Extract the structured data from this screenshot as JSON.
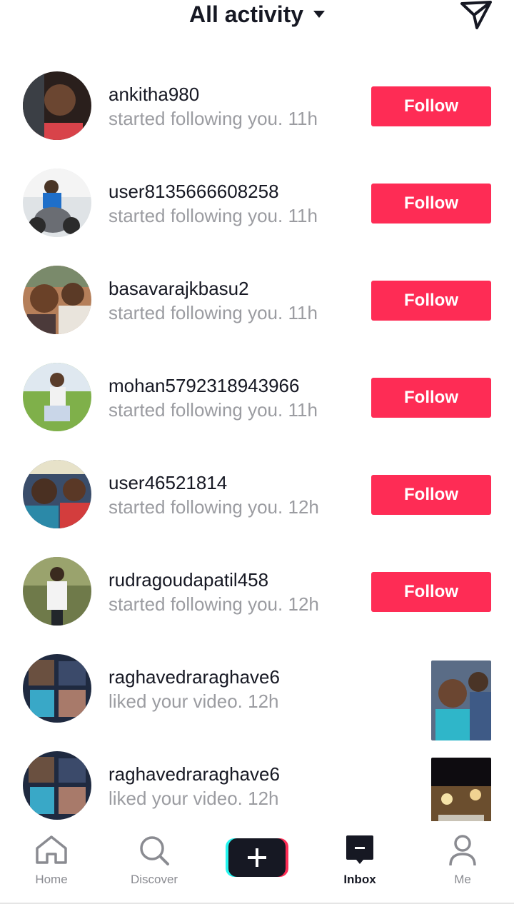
{
  "header": {
    "title": "All activity",
    "send_icon": "send-paper-plane-icon"
  },
  "items": [
    {
      "username": "ankitha980",
      "action": "started following you.",
      "time": "11h",
      "button": "Follow"
    },
    {
      "username": "user8135666608258",
      "action": "started following you.",
      "time": "11h",
      "button": "Follow"
    },
    {
      "username": "basavarajkbasu2",
      "action": "started following you.",
      "time": "11h",
      "button": "Follow"
    },
    {
      "username": "mohan5792318943966",
      "action": "started following you.",
      "time": "11h",
      "button": "Follow"
    },
    {
      "username": "user46521814",
      "action": "started following you.",
      "time": "12h",
      "button": "Follow"
    },
    {
      "username": "rudragoudapatil458",
      "action": "started following you.",
      "time": "12h",
      "button": "Follow"
    },
    {
      "username": "raghavedraraghave6",
      "action": "liked your video.",
      "time": "12h"
    },
    {
      "username": "raghavedraraghave6",
      "action": "liked your video.",
      "time": "12h"
    }
  ],
  "tabbar": {
    "home": "Home",
    "discover": "Discover",
    "inbox": "Inbox",
    "me": "Me"
  },
  "colors": {
    "accent": "#fe2c55",
    "text": "#161823",
    "secondary": "#9b9ca1"
  }
}
